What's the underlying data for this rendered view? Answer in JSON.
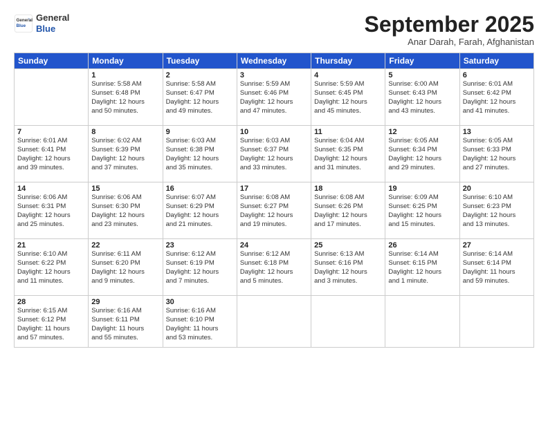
{
  "header": {
    "logo": {
      "general": "General",
      "blue": "Blue"
    },
    "title": "September 2025",
    "subtitle": "Anar Darah, Farah, Afghanistan"
  },
  "calendar": {
    "days_of_week": [
      "Sunday",
      "Monday",
      "Tuesday",
      "Wednesday",
      "Thursday",
      "Friday",
      "Saturday"
    ],
    "weeks": [
      [
        {
          "day": "",
          "info": ""
        },
        {
          "day": "1",
          "info": "Sunrise: 5:58 AM\nSunset: 6:48 PM\nDaylight: 12 hours\nand 50 minutes."
        },
        {
          "day": "2",
          "info": "Sunrise: 5:58 AM\nSunset: 6:47 PM\nDaylight: 12 hours\nand 49 minutes."
        },
        {
          "day": "3",
          "info": "Sunrise: 5:59 AM\nSunset: 6:46 PM\nDaylight: 12 hours\nand 47 minutes."
        },
        {
          "day": "4",
          "info": "Sunrise: 5:59 AM\nSunset: 6:45 PM\nDaylight: 12 hours\nand 45 minutes."
        },
        {
          "day": "5",
          "info": "Sunrise: 6:00 AM\nSunset: 6:43 PM\nDaylight: 12 hours\nand 43 minutes."
        },
        {
          "day": "6",
          "info": "Sunrise: 6:01 AM\nSunset: 6:42 PM\nDaylight: 12 hours\nand 41 minutes."
        }
      ],
      [
        {
          "day": "7",
          "info": "Sunrise: 6:01 AM\nSunset: 6:41 PM\nDaylight: 12 hours\nand 39 minutes."
        },
        {
          "day": "8",
          "info": "Sunrise: 6:02 AM\nSunset: 6:39 PM\nDaylight: 12 hours\nand 37 minutes."
        },
        {
          "day": "9",
          "info": "Sunrise: 6:03 AM\nSunset: 6:38 PM\nDaylight: 12 hours\nand 35 minutes."
        },
        {
          "day": "10",
          "info": "Sunrise: 6:03 AM\nSunset: 6:37 PM\nDaylight: 12 hours\nand 33 minutes."
        },
        {
          "day": "11",
          "info": "Sunrise: 6:04 AM\nSunset: 6:35 PM\nDaylight: 12 hours\nand 31 minutes."
        },
        {
          "day": "12",
          "info": "Sunrise: 6:05 AM\nSunset: 6:34 PM\nDaylight: 12 hours\nand 29 minutes."
        },
        {
          "day": "13",
          "info": "Sunrise: 6:05 AM\nSunset: 6:33 PM\nDaylight: 12 hours\nand 27 minutes."
        }
      ],
      [
        {
          "day": "14",
          "info": "Sunrise: 6:06 AM\nSunset: 6:31 PM\nDaylight: 12 hours\nand 25 minutes."
        },
        {
          "day": "15",
          "info": "Sunrise: 6:06 AM\nSunset: 6:30 PM\nDaylight: 12 hours\nand 23 minutes."
        },
        {
          "day": "16",
          "info": "Sunrise: 6:07 AM\nSunset: 6:29 PM\nDaylight: 12 hours\nand 21 minutes."
        },
        {
          "day": "17",
          "info": "Sunrise: 6:08 AM\nSunset: 6:27 PM\nDaylight: 12 hours\nand 19 minutes."
        },
        {
          "day": "18",
          "info": "Sunrise: 6:08 AM\nSunset: 6:26 PM\nDaylight: 12 hours\nand 17 minutes."
        },
        {
          "day": "19",
          "info": "Sunrise: 6:09 AM\nSunset: 6:25 PM\nDaylight: 12 hours\nand 15 minutes."
        },
        {
          "day": "20",
          "info": "Sunrise: 6:10 AM\nSunset: 6:23 PM\nDaylight: 12 hours\nand 13 minutes."
        }
      ],
      [
        {
          "day": "21",
          "info": "Sunrise: 6:10 AM\nSunset: 6:22 PM\nDaylight: 12 hours\nand 11 minutes."
        },
        {
          "day": "22",
          "info": "Sunrise: 6:11 AM\nSunset: 6:20 PM\nDaylight: 12 hours\nand 9 minutes."
        },
        {
          "day": "23",
          "info": "Sunrise: 6:12 AM\nSunset: 6:19 PM\nDaylight: 12 hours\nand 7 minutes."
        },
        {
          "day": "24",
          "info": "Sunrise: 6:12 AM\nSunset: 6:18 PM\nDaylight: 12 hours\nand 5 minutes."
        },
        {
          "day": "25",
          "info": "Sunrise: 6:13 AM\nSunset: 6:16 PM\nDaylight: 12 hours\nand 3 minutes."
        },
        {
          "day": "26",
          "info": "Sunrise: 6:14 AM\nSunset: 6:15 PM\nDaylight: 12 hours\nand 1 minute."
        },
        {
          "day": "27",
          "info": "Sunrise: 6:14 AM\nSunset: 6:14 PM\nDaylight: 11 hours\nand 59 minutes."
        }
      ],
      [
        {
          "day": "28",
          "info": "Sunrise: 6:15 AM\nSunset: 6:12 PM\nDaylight: 11 hours\nand 57 minutes."
        },
        {
          "day": "29",
          "info": "Sunrise: 6:16 AM\nSunset: 6:11 PM\nDaylight: 11 hours\nand 55 minutes."
        },
        {
          "day": "30",
          "info": "Sunrise: 6:16 AM\nSunset: 6:10 PM\nDaylight: 11 hours\nand 53 minutes."
        },
        {
          "day": "",
          "info": ""
        },
        {
          "day": "",
          "info": ""
        },
        {
          "day": "",
          "info": ""
        },
        {
          "day": "",
          "info": ""
        }
      ]
    ]
  }
}
